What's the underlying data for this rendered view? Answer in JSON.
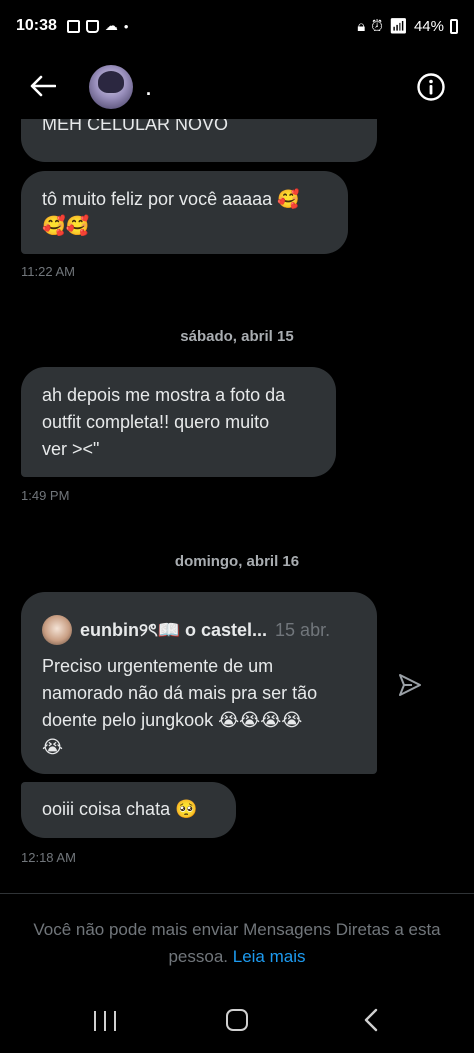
{
  "status": {
    "time": "10:38",
    "battery": "44%"
  },
  "header": {
    "name": "."
  },
  "messages": [
    {
      "text": "MEH CELULAR NOVO"
    },
    {
      "text": "tô muito feliz por você aaaaa 🥰",
      "text2": "🥰🥰",
      "time": "11:22 AM"
    },
    {
      "day": "sábado, abril 15"
    },
    {
      "line1": "ah depois me mostra a foto da",
      "line2": "outfit completa!! quero muito",
      "line3": "ver ><\"",
      "time": "1:49 PM"
    },
    {
      "day": "domingo, abril 16"
    },
    {
      "quote_author": "eunbin୨ৎ📖 o castel...",
      "quote_date": "15 abr.",
      "line1": "Preciso urgentemente de um",
      "line2": "namorado não dá mais pra ser tão",
      "line3": "doente pelo jungkook 😭😭😭😭",
      "line4": "😭"
    },
    {
      "text": "ooiii coisa chata 🥺",
      "time": "12:18 AM"
    }
  ],
  "notice": {
    "text": "Você não pode mais enviar Mensagens Diretas a esta pessoa.",
    "link": "Leia mais"
  },
  "icons": {
    "back": "arrow-left-icon",
    "info": "info-icon",
    "share": "send-icon"
  }
}
